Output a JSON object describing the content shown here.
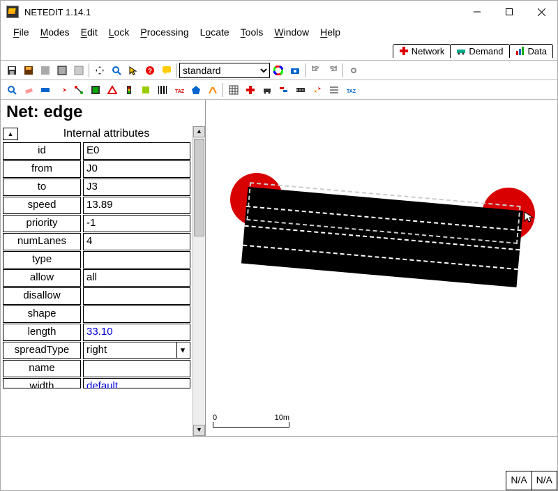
{
  "window": {
    "title": "NETEDIT 1.14.1"
  },
  "menu": [
    "File",
    "Modes",
    "Edit",
    "Lock",
    "Processing",
    "Locate",
    "Tools",
    "Window",
    "Help"
  ],
  "mode_tabs": {
    "network": "Network",
    "demand": "Demand",
    "data": "Data"
  },
  "toolbar2": {
    "selector_value": "standard"
  },
  "side": {
    "heading": "Net: edge",
    "section": "Internal attributes",
    "attrs": [
      {
        "k": "id",
        "v": "E0"
      },
      {
        "k": "from",
        "v": "J0"
      },
      {
        "k": "to",
        "v": "J3"
      },
      {
        "k": "speed",
        "v": "13.89"
      },
      {
        "k": "priority",
        "v": "-1"
      },
      {
        "k": "numLanes",
        "v": "4"
      },
      {
        "k": "type",
        "v": ""
      },
      {
        "k": "allow",
        "v": "all",
        "btn": true
      },
      {
        "k": "disallow",
        "v": "",
        "btn": true
      },
      {
        "k": "shape",
        "v": ""
      },
      {
        "k": "length",
        "v": "33.10",
        "link": true
      },
      {
        "k": "spreadType",
        "v": "right",
        "dd": true
      },
      {
        "k": "name",
        "v": ""
      },
      {
        "k": "width",
        "v": "default",
        "link": true
      }
    ]
  },
  "scale": {
    "zero": "0",
    "ten": "10m"
  },
  "status": {
    "a": "N/A",
    "b": "N/A"
  }
}
